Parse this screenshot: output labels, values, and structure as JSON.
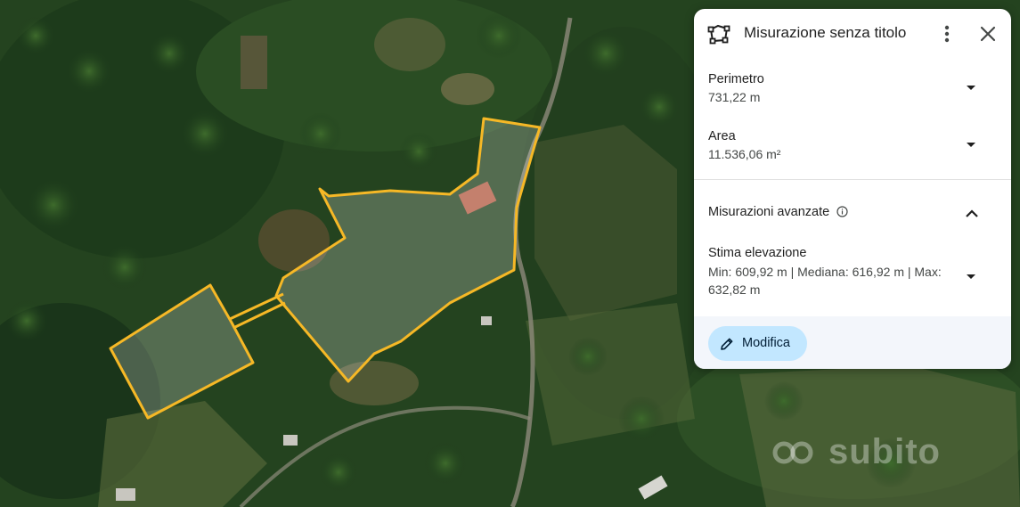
{
  "panel": {
    "title": "Misurazione senza titolo",
    "icons": {
      "header": "polygon-measure-icon",
      "more": "more-vert-icon",
      "close": "close-icon"
    },
    "perimeter": {
      "label": "Perimetro",
      "value": "731,22 m"
    },
    "area": {
      "label": "Area",
      "value": "11.536,06 m²"
    },
    "advanced": {
      "label": "Misurazioni avanzate",
      "expanded": true,
      "elevation": {
        "label": "Stima elevazione",
        "value": "Min: 609,92 m | Mediana: 616,92 m | Max: 632,82 m"
      }
    },
    "edit_button": {
      "label": "Modifica",
      "icon": "pencil-icon"
    }
  },
  "map": {
    "outline_color": "#f6b826"
  },
  "watermark": {
    "text": "subito"
  }
}
